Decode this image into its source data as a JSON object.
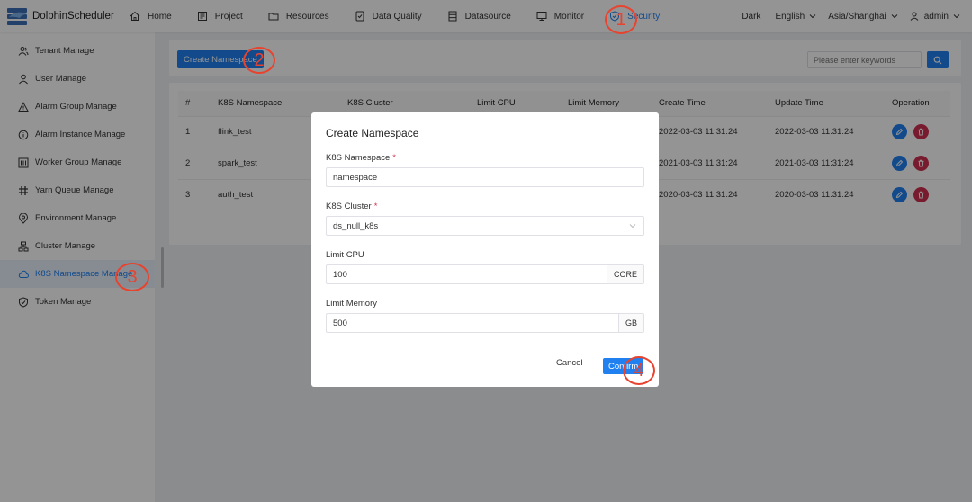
{
  "app": {
    "title": "DolphinScheduler"
  },
  "nav": {
    "items": [
      {
        "label": "Home",
        "icon": "home-icon"
      },
      {
        "label": "Project",
        "icon": "project-icon"
      },
      {
        "label": "Resources",
        "icon": "folder-icon"
      },
      {
        "label": "Data Quality",
        "icon": "data-quality-icon"
      },
      {
        "label": "Datasource",
        "icon": "datasource-icon"
      },
      {
        "label": "Monitor",
        "icon": "monitor-icon"
      },
      {
        "label": "Security",
        "icon": "shield-icon",
        "active": true
      }
    ],
    "theme": "Dark",
    "language": "English",
    "timezone": "Asia/Shanghai",
    "user": "admin"
  },
  "sidebar": {
    "items": [
      {
        "label": "Tenant Manage",
        "icon": "tenant-icon"
      },
      {
        "label": "User Manage",
        "icon": "user-icon"
      },
      {
        "label": "Alarm Group Manage",
        "icon": "warning-icon"
      },
      {
        "label": "Alarm Instance Manage",
        "icon": "info-icon"
      },
      {
        "label": "Worker Group Manage",
        "icon": "worker-group-icon"
      },
      {
        "label": "Yarn Queue Manage",
        "icon": "queue-icon"
      },
      {
        "label": "Environment Manage",
        "icon": "environment-icon"
      },
      {
        "label": "Cluster Manage",
        "icon": "cluster-icon"
      },
      {
        "label": "K8S Namespace Manage",
        "icon": "cloud-icon",
        "active": true
      },
      {
        "label": "Token Manage",
        "icon": "token-icon"
      }
    ]
  },
  "toolbar": {
    "create_label": "Create Namespace",
    "search_placeholder": "Please enter keywords"
  },
  "table": {
    "columns": [
      "#",
      "K8S Namespace",
      "K8S Cluster",
      "Limit CPU",
      "Limit Memory",
      "Create Time",
      "Update Time",
      "Operation"
    ],
    "rows": [
      {
        "index": "1",
        "namespace": "flink_test",
        "create_time": "2022-03-03 11:31:24",
        "update_time": "2022-03-03 11:31:24"
      },
      {
        "index": "2",
        "namespace": "spark_test",
        "create_time": "2021-03-03 11:31:24",
        "update_time": "2021-03-03 11:31:24"
      },
      {
        "index": "3",
        "namespace": "auth_test",
        "create_time": "2020-03-03 11:31:24",
        "update_time": "2020-03-03 11:31:24"
      }
    ]
  },
  "modal": {
    "title": "Create Namespace",
    "fields": {
      "namespace": {
        "label": "K8S Namespace",
        "required_mark": "*",
        "value": "namespace"
      },
      "cluster": {
        "label": "K8S Cluster",
        "required_mark": "*",
        "value": "ds_null_k8s"
      },
      "cpu": {
        "label": "Limit CPU",
        "value": "100",
        "suffix": "CORE"
      },
      "memory": {
        "label": "Limit Memory",
        "value": "500",
        "suffix": "GB"
      }
    },
    "cancel_label": "Cancel",
    "confirm_label": "Confirm"
  },
  "annotations": [
    "1",
    "2",
    "3",
    "4"
  ],
  "colors": {
    "primary": "#2080f0",
    "danger": "#d03050",
    "annotation": "#e8432e"
  }
}
